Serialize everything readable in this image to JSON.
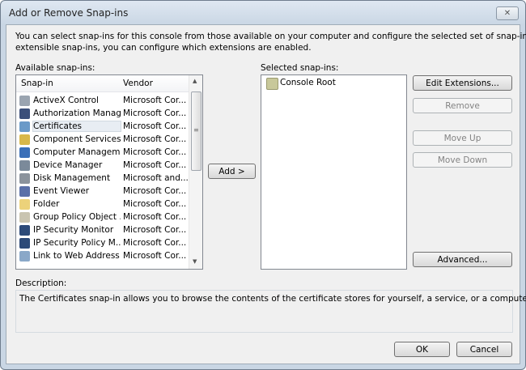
{
  "window": {
    "title": "Add or Remove Snap-ins",
    "close_icon": "close-icon"
  },
  "intro": [
    "You can select snap-ins for this console from those available on your computer and configure the selected set of snap-ins. For",
    "extensible snap-ins, you can configure which extensions are enabled."
  ],
  "available": {
    "label": "Available snap-ins:",
    "col_snapin": "Snap-in",
    "col_vendor": "Vendor",
    "items": [
      {
        "name": "ActiveX Control",
        "vendor": "Microsoft Cor...",
        "color": "#9aa4b0"
      },
      {
        "name": "Authorization Manager",
        "vendor": "Microsoft Cor...",
        "color": "#3b4f7a"
      },
      {
        "name": "Certificates",
        "vendor": "Microsoft Cor...",
        "color": "#6a9ac8",
        "selected": true
      },
      {
        "name": "Component Services",
        "vendor": "Microsoft Cor...",
        "color": "#d8b84a"
      },
      {
        "name": "Computer Managem...",
        "vendor": "Microsoft Cor...",
        "color": "#3a6fb8"
      },
      {
        "name": "Device Manager",
        "vendor": "Microsoft Cor...",
        "color": "#7b8a9a"
      },
      {
        "name": "Disk Management",
        "vendor": "Microsoft and...",
        "color": "#8b939c"
      },
      {
        "name": "Event Viewer",
        "vendor": "Microsoft Cor...",
        "color": "#5a70a8"
      },
      {
        "name": "Folder",
        "vendor": "Microsoft Cor...",
        "color": "#ecd27a"
      },
      {
        "name": "Group Policy Object ...",
        "vendor": "Microsoft Cor...",
        "color": "#c9c4b0"
      },
      {
        "name": "IP Security Monitor",
        "vendor": "Microsoft Cor...",
        "color": "#2c4a78"
      },
      {
        "name": "IP Security Policy M...",
        "vendor": "Microsoft Cor...",
        "color": "#2c4a78"
      },
      {
        "name": "Link to Web Address",
        "vendor": "Microsoft Cor...",
        "color": "#8aa8c8"
      }
    ]
  },
  "add_button": "Add >",
  "selected": {
    "label": "Selected snap-ins:",
    "items": [
      "Console Root"
    ]
  },
  "buttons": {
    "edit_extensions": "Edit Extensions...",
    "remove": "Remove",
    "move_up": "Move Up",
    "move_down": "Move Down",
    "advanced": "Advanced..."
  },
  "description": {
    "label": "Description:",
    "text": "The Certificates snap-in allows you to browse the contents of the certificate stores for yourself, a service, or a computer."
  },
  "ok": "OK",
  "cancel": "Cancel"
}
